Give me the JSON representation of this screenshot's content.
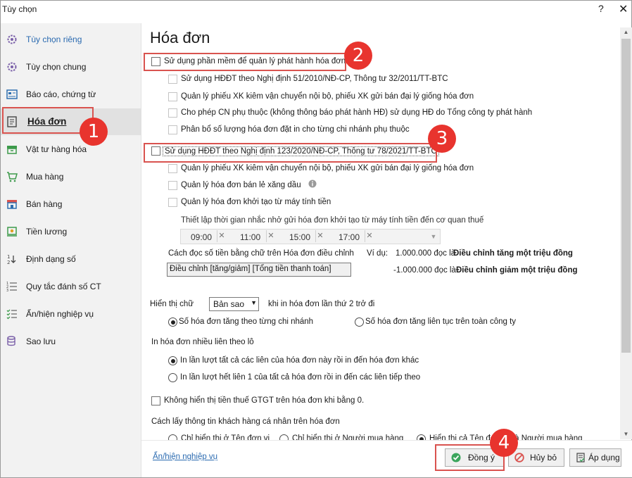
{
  "window": {
    "title": "Tùy chọn",
    "help": "?",
    "close": "✕"
  },
  "sidebar": {
    "items": [
      {
        "label": "Tùy chọn riêng",
        "icon": "gear-icon"
      },
      {
        "label": "Tùy chọn chung",
        "icon": "gear-icon"
      },
      {
        "label": "Báo cáo, chứng từ",
        "icon": "report-icon"
      },
      {
        "label": "Hóa đơn",
        "icon": "invoice-icon"
      },
      {
        "label": "Vật tư hàng hóa",
        "icon": "box-icon"
      },
      {
        "label": "Mua hàng",
        "icon": "cart-icon"
      },
      {
        "label": "Bán hàng",
        "icon": "store-icon"
      },
      {
        "label": "Tiền lương",
        "icon": "salary-icon"
      },
      {
        "label": "Định dạng số",
        "icon": "number-format-icon"
      },
      {
        "label": "Quy tắc đánh số CT",
        "icon": "list-number-icon"
      },
      {
        "label": "Ẩn/hiện nghiệp vụ",
        "icon": "checklist-icon"
      },
      {
        "label": "Sao lưu",
        "icon": "database-icon"
      }
    ]
  },
  "main": {
    "title": "Hóa đơn",
    "opt_software": "Sử dụng phần mềm để quản lý phát hành hóa đơn",
    "sub1": [
      "Sử dụng HĐĐT theo Nghị định 51/2010/NĐ-CP, Thông tư 32/2011/TT-BTC",
      "Quản lý phiếu XK kiêm vận chuyển nội bộ, phiếu XK gửi bán đại lý giống hóa đơn",
      "Cho phép CN phụ thuộc (không thông báo phát hành HĐ) sử dụng HĐ do Tổng công ty phát hành",
      "Phân bổ số lượng hóa đơn đặt in cho từng chi nhánh phụ thuộc"
    ],
    "opt_hddt": "Sử dụng HĐĐT theo Nghị định 123/2020/NĐ-CP, Thông tư 78/2021/TT-BTC",
    "sub2": [
      "Quản lý phiếu XK kiêm vận chuyển nội bộ, phiếu XK gửi bán đại lý giống hóa đơn",
      "Quản lý hóa đơn bán lẻ xăng dầu",
      "Quản lý hóa đơn khởi tạo từ máy tính tiền"
    ],
    "reminder_label": "Thiết lập thời gian nhắc nhở gửi hóa đơn khởi tạo từ máy tính tiền đến cơ quan thuế",
    "times": [
      "09:00",
      "11:00",
      "15:00",
      "17:00"
    ],
    "read_label": "Cách đọc số tiền bằng chữ trên Hóa đơn điều chỉnh",
    "read_value": "Điều chỉnh [tăng/giảm] [Tổng tiền thanh toán]",
    "example_prefix": "Ví dụ:",
    "example1_num": "1.000.000 đọc là",
    "example1_bold": "Điều chỉnh tăng một triệu đồng",
    "example2_num": "-1.000.000 đọc là",
    "example2_bold": "Điều chỉnh giảm một triệu đồng",
    "display_label": "Hiển thị chữ",
    "display_value": "Bản sao",
    "display_suffix": "khi in hóa đơn lần thứ 2 trở đi",
    "radio_branch": "Số hóa đơn tăng theo từng chi nhánh",
    "radio_company": "Số hóa đơn tăng liên tục trên toàn công ty",
    "print_multi_label": "In hóa đơn nhiều liên theo lô",
    "print_opt1": "In lần lượt tất cả các liên của hóa đơn này rồi in đến hóa đơn khác",
    "print_opt2": "In lần lượt hết liên 1 của tất cả hóa đơn rồi in đến các liên tiếp theo",
    "vat_hide": "Không hiển thị tiền thuế GTGT trên hóa đơn khi bằng 0.",
    "customer_info_label": "Cách lấy thông tin khách hàng cá nhân trên hóa đơn",
    "cust_opts": [
      "Chỉ hiển thị ở Tên đơn vị",
      "Chỉ hiển thị ở Người mua hàng",
      "Hiển thị cả Tên đơn vị và Người mua hàng"
    ]
  },
  "badges": [
    "1",
    "2",
    "3",
    "4"
  ],
  "footer": {
    "link": "Ẩn/hiện nghiệp vụ",
    "ok": "Đồng ý",
    "cancel": "Hủy bỏ",
    "apply": "Áp dụng"
  },
  "colors": {
    "highlight": "#d9534f",
    "badge": "#e8342e",
    "link": "#2a6ab0",
    "selected_bg": "#e1e1e1"
  }
}
